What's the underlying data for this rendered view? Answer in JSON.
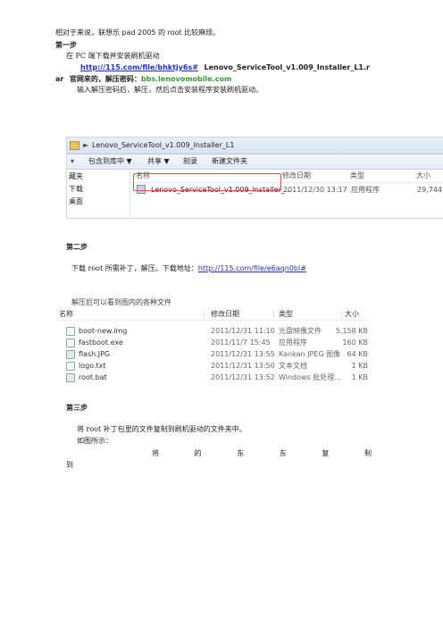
{
  "intro": "相对于来说，联想乐 pad 2005 的 root 比较麻烦。",
  "step1": {
    "heading": "第一步",
    "line1": "在 PC 端下载并安装刷机驱动",
    "link": "http://115.com/file/bhktjy6s#",
    "link_tail_a": "Lenovo_ServiceTool_v1.009_Installer_L1.r",
    "link_tail_b": "ar",
    "pw_label": "官网来的，解压密码：",
    "pw_value": "bbs.lenovomobile.com",
    "line3": "输入解压密码后，解压，然后点击安装程序安装刷机驱动。"
  },
  "explorer1": {
    "path": "Lenovo_ServiceTool_v1.009_Installer_L1",
    "toolbar": [
      "包含到库中 ▼",
      "共享 ▼",
      "刻录",
      "新建文件夹"
    ],
    "sidebar": [
      "藏夹",
      "下载",
      "桌面"
    ],
    "columns": [
      "名称",
      "修改日期",
      "类型",
      "大小"
    ],
    "file": {
      "name": "Lenovo_ServiceTool_v1.009_Installer_...",
      "date": "2011/12/30 13:17",
      "type": "应用程序",
      "size": "29,744"
    }
  },
  "step2": {
    "heading": "第二步",
    "line1_prefix": "下载 root 所需补丁，解压。下载地址：",
    "link": "http://115.com/file/e6aqn0bl#",
    "line2": "解压后可以看到图内的各种文件"
  },
  "explorer2": {
    "columns": [
      "名称",
      "修改日期",
      "类型",
      "大小"
    ],
    "files": [
      {
        "name": "boot-new.img",
        "date": "2011/12/31 11:10",
        "type": "光盘映像文件",
        "size": "5,158 KB"
      },
      {
        "name": "fastboot.exe",
        "date": "2011/11/7 15:45",
        "type": "应用程序",
        "size": "160 KB"
      },
      {
        "name": "flash.JPG",
        "date": "2011/12/31 13:55",
        "type": "Kankan JPEG 图像",
        "size": "64 KB"
      },
      {
        "name": "logo.txt",
        "date": "2011/12/31 13:50",
        "type": "文本文档",
        "size": "1 KB"
      },
      {
        "name": "root.bat",
        "date": "2011/12/31 13:52",
        "type": "Windows 批处理...",
        "size": "1 KB"
      }
    ]
  },
  "step3": {
    "heading": "第三步",
    "line1": "将 root 补丁包里的文件复制到刷机驱动的文件夹中。",
    "line2": "如图所示：",
    "spread": [
      "将",
      "的",
      "东",
      "东",
      "复",
      "制"
    ],
    "line4": "到"
  }
}
